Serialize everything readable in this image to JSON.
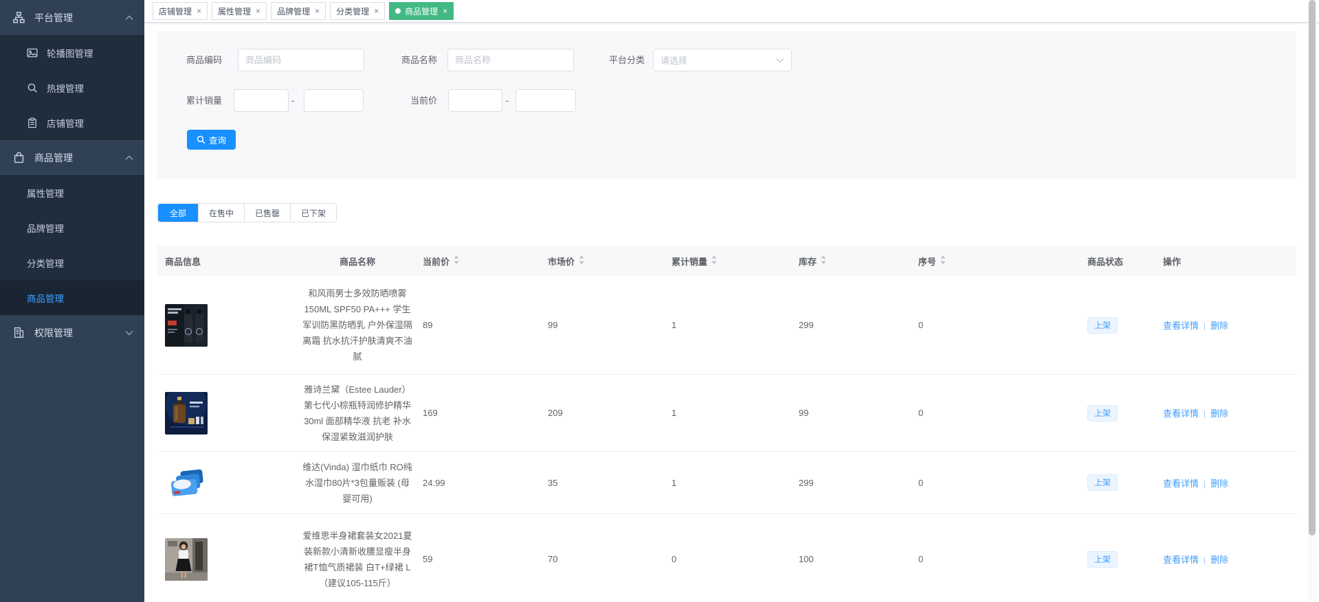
{
  "colors": {
    "accent": "#1890ff",
    "link": "#409eff",
    "active_tag": "#42b983",
    "sidebar_bg": "#304156",
    "submenu_bg": "#1f2d3d",
    "status_tag_text": "#409eff"
  },
  "glyphs": {
    "close": "×",
    "range_separator": "-",
    "action_divider": "|"
  },
  "sidebar": {
    "groups": [
      {
        "label": "平台管理",
        "icon": "sitemap-icon",
        "expanded": true,
        "children": [
          {
            "label": "轮播图管理",
            "icon": "image-icon"
          },
          {
            "label": "热搜管理",
            "icon": "search-icon"
          },
          {
            "label": "店铺管理",
            "icon": "clipboard-icon"
          }
        ]
      },
      {
        "label": "商品管理",
        "icon": "bag-icon",
        "expanded": true,
        "children": [
          {
            "label": "属性管理"
          },
          {
            "label": "品牌管理"
          },
          {
            "label": "分类管理"
          },
          {
            "label": "商品管理",
            "active": true
          }
        ]
      },
      {
        "label": "权限管理",
        "icon": "building-icon",
        "expanded": false,
        "children": []
      }
    ]
  },
  "tags": [
    {
      "label": "店铺管理",
      "active": false
    },
    {
      "label": "属性管理",
      "active": false
    },
    {
      "label": "品牌管理",
      "active": false
    },
    {
      "label": "分类管理",
      "active": false
    },
    {
      "label": "商品管理",
      "active": true
    }
  ],
  "search_form": {
    "code_label": "商品编码",
    "code_placeholder": "商品编码",
    "name_label": "商品名称",
    "name_placeholder": "商品名称",
    "category_label": "平台分类",
    "category_placeholder": "请选择",
    "sales_label": "累计销量",
    "price_label": "当前价",
    "search_button": "查询"
  },
  "filter_tabs": [
    {
      "label": "全部",
      "active": true
    },
    {
      "label": "在售中",
      "active": false
    },
    {
      "label": "已售罄",
      "active": false
    },
    {
      "label": "已下架",
      "active": false
    }
  ],
  "table": {
    "columns": [
      {
        "label": "商品信息",
        "sortable": false
      },
      {
        "label": "商品名称",
        "sortable": false
      },
      {
        "label": "当前价",
        "sortable": true
      },
      {
        "label": "市场价",
        "sortable": true
      },
      {
        "label": "累计销量",
        "sortable": true
      },
      {
        "label": "库存",
        "sortable": true
      },
      {
        "label": "序号",
        "sortable": true
      },
      {
        "label": "商品状态",
        "sortable": false
      },
      {
        "label": "操作",
        "sortable": false
      }
    ],
    "actions": {
      "view": "查看详情",
      "delete": "删除"
    },
    "rows": [
      {
        "image": "sunscreen-spray",
        "name": "和风雨男士多效防晒喷雾150ML SPF50 PA+++ 学生军训防黑防晒乳 户外保湿隔离霜 抗水抗汗护肤清爽不油腻",
        "current_price": "89",
        "market_price": "99",
        "sales": "1",
        "stock": "299",
        "seq": "0",
        "status": "上架"
      },
      {
        "image": "estee-lauder-serum",
        "name": "雅诗兰黛（Estee Lauder）第七代小棕瓶特润修护精华30ml 面部精华液 抗老 补水保湿紧致滋润护肤",
        "current_price": "169",
        "market_price": "209",
        "sales": "1",
        "stock": "99",
        "seq": "0",
        "status": "上架"
      },
      {
        "image": "vinda-wipes",
        "name": "维达(Vinda) 湿巾纸巾 RO纯水湿巾80片*3包量贩装 (母婴可用)",
        "current_price": "24.99",
        "market_price": "35",
        "sales": "1",
        "stock": "299",
        "seq": "0",
        "status": "上架"
      },
      {
        "image": "skirt-suit",
        "name": "爱维思半身裙套装女2021夏装新款小清新收腰显瘦半身裙T恤气质裙装 白T+绿裙 L（建议105-115斤）",
        "current_price": "59",
        "market_price": "70",
        "sales": "0",
        "stock": "100",
        "seq": "0",
        "status": "上架"
      }
    ]
  }
}
